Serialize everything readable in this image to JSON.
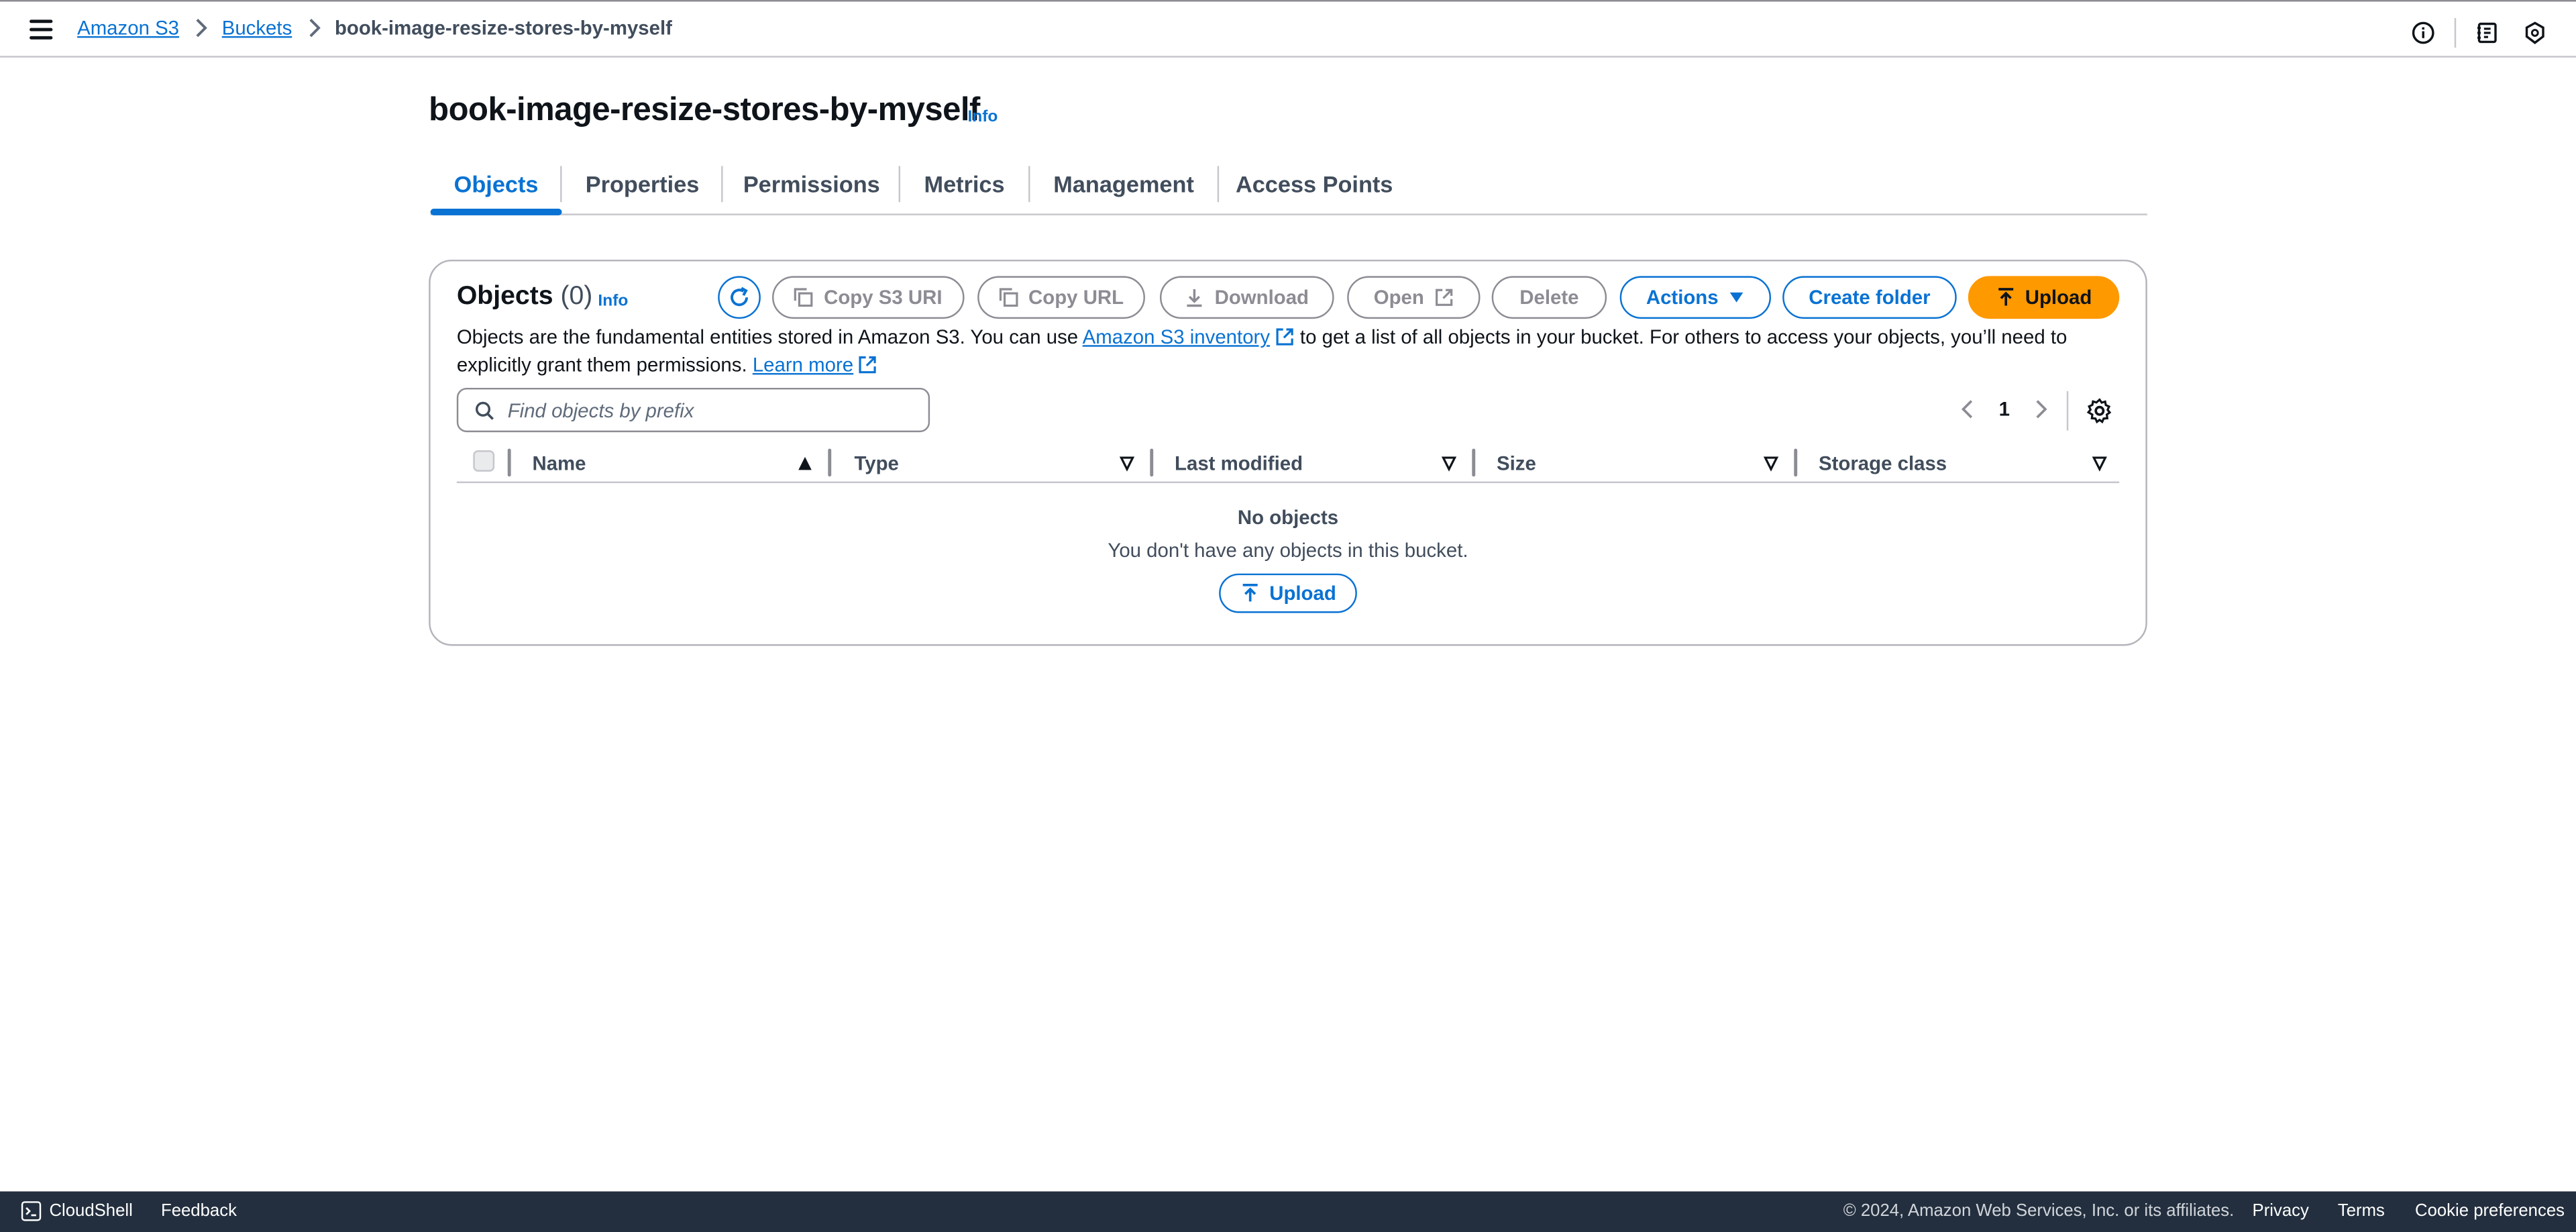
{
  "breadcrumb": {
    "items": [
      "Amazon S3",
      "Buckets"
    ],
    "current": "book-image-resize-stores-by-myself"
  },
  "header": {
    "title": "book-image-resize-stores-by-myself",
    "info": "Info"
  },
  "tabs": [
    {
      "label": "Objects",
      "active": true
    },
    {
      "label": "Properties"
    },
    {
      "label": "Permissions"
    },
    {
      "label": "Metrics"
    },
    {
      "label": "Management"
    },
    {
      "label": "Access Points"
    }
  ],
  "objects": {
    "title": "Objects",
    "count": "(0)",
    "info": "Info",
    "buttons": {
      "copy_s3_uri": "Copy S3 URI",
      "copy_url": "Copy URL",
      "download": "Download",
      "open": "Open",
      "delete": "Delete",
      "actions": "Actions",
      "create_folder": "Create folder",
      "upload": "Upload"
    },
    "description": {
      "part1": "Objects are the fundamental entities stored in Amazon S3. You can use ",
      "link1": "Amazon S3 inventory",
      "part2": " to get a list of all objects in your bucket. For others to access your objects, you’ll need to explicitly grant them permissions. ",
      "link2": "Learn more"
    },
    "search_placeholder": "Find objects by prefix",
    "page": "1",
    "columns": [
      "Name",
      "Type",
      "Last modified",
      "Size",
      "Storage class"
    ],
    "empty_title": "No objects",
    "empty_text": "You don't have any objects in this bucket.",
    "empty_upload": "Upload"
  },
  "footer": {
    "cloudshell": "CloudShell",
    "feedback": "Feedback",
    "copyright": "© 2024, Amazon Web Services, Inc. or its affiliates.",
    "privacy": "Privacy",
    "terms": "Terms",
    "cookies": "Cookie preferences"
  },
  "colors": {
    "accent": "#0972d3",
    "upload": "#ff9900",
    "footer_bg": "#232f3e"
  }
}
